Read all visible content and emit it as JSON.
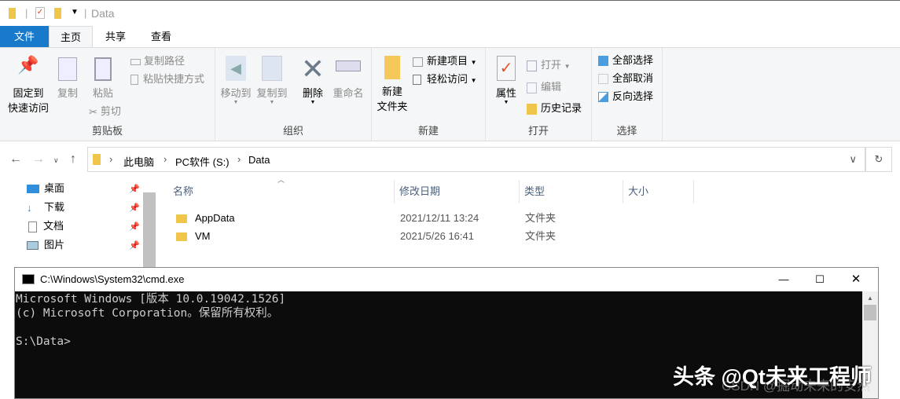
{
  "window": {
    "title": "Data"
  },
  "tabs": {
    "file": "文件",
    "home": "主页",
    "share": "共享",
    "view": "查看"
  },
  "ribbon": {
    "clipboard": {
      "label": "剪贴板",
      "pin": "固定到\n快速访问",
      "pin1": "固定到",
      "pin2": "快速访问",
      "copy": "复制",
      "paste": "粘贴",
      "copy_path": "复制路径",
      "paste_shortcut": "粘贴快捷方式",
      "cut": "剪切"
    },
    "organize": {
      "label": "组织",
      "move_to": "移动到",
      "copy_to": "复制到",
      "delete": "删除",
      "rename": "重命名"
    },
    "new": {
      "label": "新建",
      "new_folder1": "新建",
      "new_folder2": "文件夹",
      "new_item": "新建项目",
      "easy_access": "轻松访问"
    },
    "open": {
      "label": "打开",
      "properties": "属性",
      "open": "打开",
      "edit": "编辑",
      "history": "历史记录"
    },
    "select": {
      "label": "选择",
      "select_all": "全部选择",
      "select_none": "全部取消",
      "invert": "反向选择"
    }
  },
  "address": {
    "crumbs": [
      "此电脑",
      "PC软件 (S:)",
      "Data"
    ]
  },
  "nav": [
    {
      "label": "桌面"
    },
    {
      "label": "下载"
    },
    {
      "label": "文档"
    },
    {
      "label": "图片"
    }
  ],
  "columns": {
    "name": "名称",
    "modified": "修改日期",
    "type": "类型",
    "size": "大小"
  },
  "files": [
    {
      "name": "AppData",
      "modified": "2021/12/11 13:24",
      "type": "文件夹"
    },
    {
      "name": "VM",
      "modified": "2021/5/26 16:41",
      "type": "文件夹"
    }
  ],
  "cmd": {
    "title": "C:\\Windows\\System32\\cmd.exe",
    "lines": [
      "Microsoft Windows [版本 10.0.19042.1526]",
      "(c) Microsoft Corporation。保留所有权利。",
      "",
      "S:\\Data>"
    ]
  },
  "watermark": {
    "main": "头条 @Qt未来工程师",
    "sub": "CSDN @掘动未来的安然"
  },
  "colors": {
    "file_tab": "#1979ca",
    "cmd_bg": "#0c0c0c",
    "cmd_text": "#cccccc"
  }
}
